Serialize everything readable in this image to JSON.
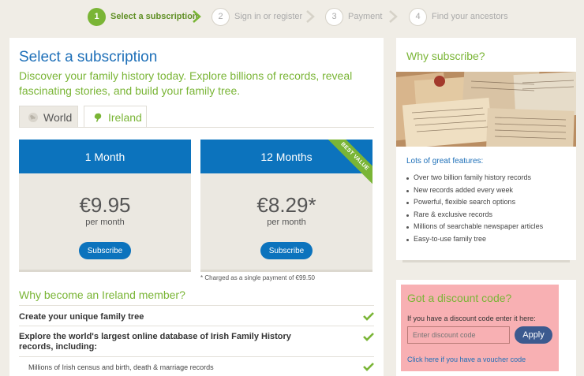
{
  "steps": [
    {
      "num": "1",
      "label": "Select a subscription"
    },
    {
      "num": "2",
      "label": "Sign in or register"
    },
    {
      "num": "3",
      "label": "Payment"
    },
    {
      "num": "4",
      "label": "Find your ancestors"
    }
  ],
  "main": {
    "title": "Select a subscription",
    "intro": "Discover your family history today. Explore billions of records, reveal fascinating stories, and build your family tree.",
    "tabs": [
      {
        "label": "World",
        "icon": "globe-icon"
      },
      {
        "label": "Ireland",
        "icon": "shamrock-icon"
      }
    ],
    "plans": [
      {
        "head": "1 Month",
        "price": "€9.95",
        "per": "per month",
        "button": "Subscribe"
      },
      {
        "head": "12 Months",
        "price": "€8.29*",
        "per": "per month",
        "button": "Subscribe",
        "ribbon": "BEST VALUE"
      }
    ],
    "charged_note": "* Charged as a single payment of €99.50",
    "why_title": "Why become an Ireland member?",
    "features": [
      "Create your unique family tree",
      "Explore the world's largest online database of Irish Family History records, including:",
      "Millions of Irish census and birth, death & marriage records"
    ]
  },
  "sidebar": {
    "why_title": "Why subscribe?",
    "lots": "Lots of great features:",
    "items": [
      "Over two billion family history records",
      "New records added every week",
      "Powerful, flexible search options",
      "Rare & exclusive records",
      "Millions of searchable newspaper articles",
      "Easy-to-use family tree"
    ]
  },
  "discount": {
    "title": "Got a discount code?",
    "instructions": "If you have a discount code enter it here:",
    "placeholder": "Enter discount code",
    "apply": "Apply",
    "voucher": "Click here if you have a voucher code"
  },
  "colors": {
    "green": "#7ab536",
    "blue": "#0c73bd",
    "discount_bg": "#f8b0b3"
  }
}
